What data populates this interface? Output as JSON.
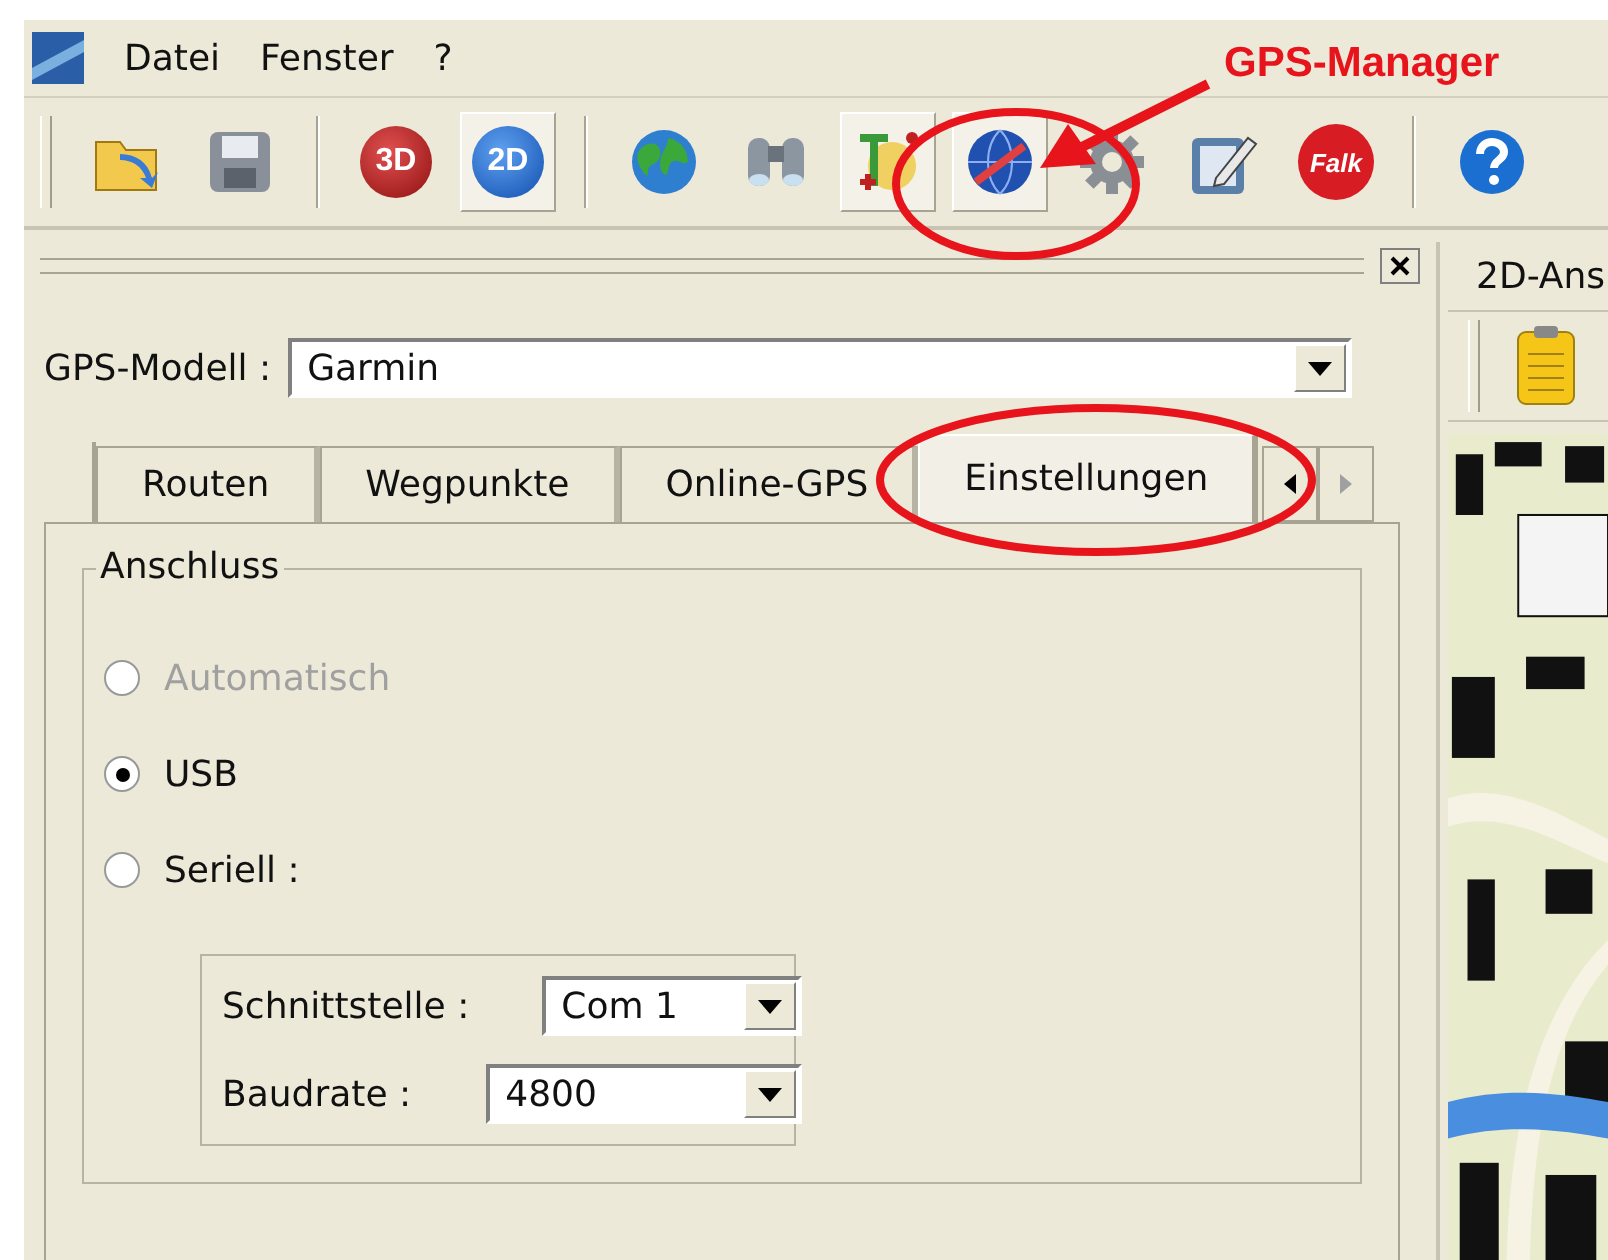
{
  "menu": {
    "items": [
      "Datei",
      "Fenster",
      "?"
    ]
  },
  "toolbar": {
    "buttons": [
      {
        "kind": "open",
        "pressed": false
      },
      {
        "kind": "save",
        "pressed": false
      },
      {
        "kind": "sep"
      },
      {
        "kind": "badge3d",
        "text": "3D",
        "pressed": false
      },
      {
        "kind": "badge2d",
        "text": "2D",
        "pressed": true
      },
      {
        "kind": "sep"
      },
      {
        "kind": "globe",
        "pressed": false
      },
      {
        "kind": "binoculars",
        "pressed": false
      },
      {
        "kind": "tracker",
        "pressed": true
      },
      {
        "kind": "gps",
        "pressed": true
      },
      {
        "kind": "gear",
        "pressed": false
      },
      {
        "kind": "edit",
        "pressed": false
      },
      {
        "kind": "falk",
        "text": "Falk",
        "pressed": false
      },
      {
        "kind": "sep"
      },
      {
        "kind": "help",
        "pressed": false
      }
    ]
  },
  "gps_panel": {
    "model": {
      "label": "GPS-Modell :",
      "value": "Garmin"
    },
    "tabs": [
      {
        "label": "Routen",
        "selected": false
      },
      {
        "label": "Wegpunkte",
        "selected": false
      },
      {
        "label": "Online-GPS",
        "selected": false
      },
      {
        "label": "Einstellungen",
        "selected": true
      }
    ],
    "group": {
      "title": "Anschluss",
      "radios": [
        {
          "label": "Automatisch",
          "selected": false,
          "disabled": true
        },
        {
          "label": "USB",
          "selected": true,
          "disabled": false
        },
        {
          "label": "Seriell :",
          "selected": false,
          "disabled": false
        }
      ],
      "serial_fields": [
        {
          "label": "Schnittstelle :",
          "value": "Com 1"
        },
        {
          "label": "Baudrate :",
          "value": "4800"
        }
      ]
    }
  },
  "view_panel": {
    "tab": "2D-Ans"
  },
  "annotation": {
    "label": "GPS-Manager"
  }
}
